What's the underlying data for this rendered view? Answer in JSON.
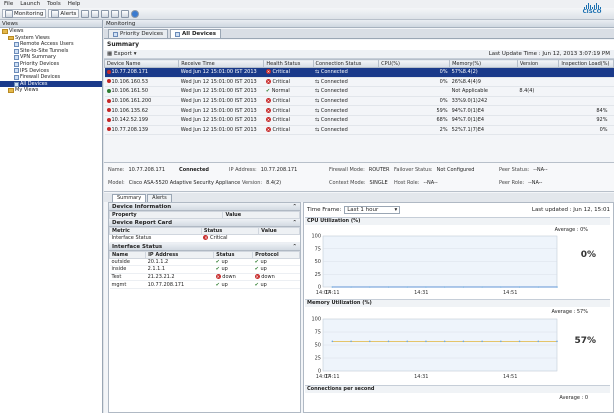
{
  "menu": [
    "File",
    "Launch",
    "Tools",
    "Help"
  ],
  "toolbar": {
    "monitoring": "Monitoring",
    "alerts": "Alerts"
  },
  "brand": "CISCO",
  "left_pane": {
    "title": "Views",
    "items": [
      {
        "label": "Views",
        "level": 0
      },
      {
        "label": "System Views",
        "level": 1
      },
      {
        "label": "Remote Access Users",
        "level": 2
      },
      {
        "label": "Site-to-Site Tunnels",
        "level": 2
      },
      {
        "label": "VPN Summary",
        "level": 2
      },
      {
        "label": "Priority Devices",
        "level": 2
      },
      {
        "label": "IPS Devices",
        "level": 2
      },
      {
        "label": "Firewall Devices",
        "level": 2
      },
      {
        "label": "All Devices",
        "level": 2
      },
      {
        "label": "My Views",
        "level": 1
      }
    ]
  },
  "main": {
    "title": "Monitoring",
    "tabs": [
      "Priority Devices",
      "All Devices"
    ],
    "summary_title": "Summary",
    "export": "Export",
    "last_update": "Last Update Time : Jun 12, 2013 3:07:19 PM",
    "columns": [
      "Device Name",
      "Receive Time",
      "Health Status",
      "Connection Status",
      "CPU(%)",
      "Memory(%)",
      "Version",
      "Inspection Load(%)"
    ],
    "rows": [
      {
        "name": "10.77.208.171",
        "time": "Wed Jun 12 15:01:00 IST 2013",
        "health": "Critical",
        "conn": "Connected",
        "cpu": "0%",
        "mem": "57%8.4(2)",
        "version": "",
        "load": ""
      },
      {
        "name": "10.106.160.53",
        "time": "Wed Jun 12 15:01:00 IST 2013",
        "health": "Critical",
        "conn": "Connected",
        "cpu": "0%",
        "mem": "26%8.4(4)9",
        "version": "",
        "load": ""
      },
      {
        "name": "10.106.161.50",
        "time": "Wed Jun 12 15:01:00 IST 2013",
        "health": "Normal",
        "conn": "Connected",
        "cpu": "",
        "mem": "Not Applicable",
        "version": "8.4(4)",
        "load": ""
      },
      {
        "name": "10.106.161.200",
        "time": "Wed Jun 12 15:01:00 IST 2013",
        "health": "Critical",
        "conn": "Connected",
        "cpu": "0%",
        "mem": "33%9.0(1)242",
        "version": "",
        "load": ""
      },
      {
        "name": "10.106.135.62",
        "time": "Wed Jun 12 15:01:00 IST 2013",
        "health": "Critical",
        "conn": "Connected",
        "cpu": "59%",
        "mem": "94%7.0(1)E4",
        "version": "",
        "load": "84%"
      },
      {
        "name": "10.142.52.199",
        "time": "Wed Jun 12 15:01:00 IST 2013",
        "health": "Critical",
        "conn": "Connected",
        "cpu": "68%",
        "mem": "94%7.0(1)E4",
        "version": "",
        "load": "92%"
      },
      {
        "name": "10.77.208.139",
        "time": "Wed Jun 12 15:01:00 IST 2013",
        "health": "Critical",
        "conn": "Connected",
        "cpu": "2%",
        "mem": "52%7.1(7)E4",
        "version": "",
        "load": "0%"
      }
    ]
  },
  "info": {
    "name_lbl": "Name:",
    "name": "10.77.208.171",
    "connected": "Connected",
    "ip_lbl": "IP Address:",
    "ip": "10.77.208.171",
    "fw_lbl": "Firewall Mode:",
    "fw": "ROUTER",
    "fo_lbl": "Failover Status:",
    "fo": "Not Configured",
    "peer_lbl": "Peer Status:",
    "peer": "--NA--",
    "model_lbl": "Model:",
    "model": "Cisco ASA-5520 Adaptive Security Appliance",
    "ver_lbl": "Version:",
    "ver": "8.4(2)",
    "ctx_lbl": "Context Mode:",
    "ctx": "SINGLE",
    "host_lbl": "Host Role:",
    "host": "--NA--",
    "peerrole_lbl": "Peer Role:",
    "peerrole": "--NA--"
  },
  "subtabs": [
    "Summary",
    "Alerts"
  ],
  "device_info": {
    "title": "Device Information",
    "cols": [
      "Property",
      "Value"
    ]
  },
  "report_card": {
    "title": "Device Report Card",
    "cols": [
      "Metric",
      "Status",
      "Value"
    ],
    "rows": [
      {
        "metric": "Interface Status",
        "status": "Critical"
      }
    ]
  },
  "iface": {
    "title": "Interface Status",
    "cols": [
      "Name",
      "IP Address",
      "Status",
      "Protocol"
    ],
    "rows": [
      {
        "name": "outside",
        "ip": "20.1.1.2",
        "status": "up",
        "proto": "up"
      },
      {
        "name": "inside",
        "ip": "2.1.1.1",
        "status": "up",
        "proto": "up"
      },
      {
        "name": "Test",
        "ip": "21.23.21.2",
        "status": "down",
        "proto": "down"
      },
      {
        "name": "mgmt",
        "ip": "10.77.208.171",
        "status": "up",
        "proto": "up"
      }
    ]
  },
  "timeframe": {
    "label": "Time Frame:",
    "value": "Last 1 hour",
    "updated": "Last updated : Jun 12, 15:01"
  },
  "charts": [
    {
      "title": "CPU Utilization (%)",
      "avg": "Average : 0%",
      "big": "0%",
      "yticks": [
        "100",
        "75",
        "50",
        "25",
        "0"
      ],
      "xticks": [
        "14:07",
        "14:11",
        "14:31",
        "14:51"
      ],
      "value": 0
    },
    {
      "title": "Memory Utilization (%)",
      "avg": "Average : 57%",
      "big": "57%",
      "yticks": [
        "100",
        "75",
        "50",
        "25",
        "0"
      ],
      "xticks": [
        "14:07",
        "14:11",
        "14:31",
        "14:51"
      ],
      "value": 57
    },
    {
      "title": "Connections per second",
      "avg": "Average : 0"
    }
  ]
}
